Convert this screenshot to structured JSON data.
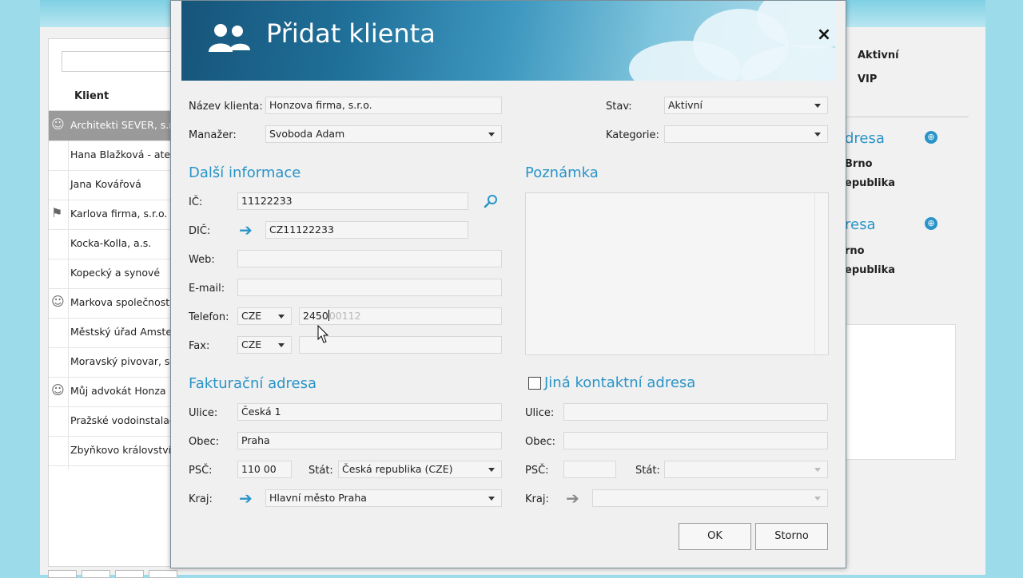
{
  "background_app": {
    "list_header": "Klient",
    "clients": [
      {
        "name": "Architekti SEVER, s.r.o.",
        "icon": "smiley-icon",
        "selected": true
      },
      {
        "name": "Hana Blažková - ateliér",
        "icon": "",
        "selected": false
      },
      {
        "name": "Jana Kovářová",
        "icon": "",
        "selected": false
      },
      {
        "name": "Karlova firma, s.r.o.",
        "icon": "flag-icon",
        "selected": false
      },
      {
        "name": "Kocka-Kolla, a.s.",
        "icon": "",
        "selected": false
      },
      {
        "name": "Kopecký a synové",
        "icon": "",
        "selected": false
      },
      {
        "name": "Markova společnost, s",
        "icon": "smiley-icon",
        "selected": false
      },
      {
        "name": "Městský úřad Amsterd",
        "icon": "",
        "selected": false
      },
      {
        "name": "Moravský pivovar, sp",
        "icon": "",
        "selected": false
      },
      {
        "name": "Můj advokát Honza",
        "icon": "smiley-icon",
        "selected": false
      },
      {
        "name": "Pražské vodoinstalace",
        "icon": "",
        "selected": false
      },
      {
        "name": "Zbyňkovo království",
        "icon": "",
        "selected": false
      }
    ],
    "right_panel": {
      "status1": "Aktivní",
      "status2": "VIP",
      "address1_head": "dresa",
      "address1_city": "Brno",
      "address1_country": "epublika",
      "address2_head": "resa",
      "address2_city": "rno",
      "address2_country": "epublika"
    }
  },
  "dialog": {
    "title": "Přidat klienta",
    "close_symbol": "×",
    "labels": {
      "name": "Název klienta:",
      "manager": "Manažer:",
      "status": "Stav:",
      "category": "Kategorie:",
      "ic": "IČ:",
      "dic": "DIČ:",
      "web": "Web:",
      "email": "E-mail:",
      "phone": "Telefon:",
      "fax": "Fax:",
      "street": "Ulice:",
      "city": "Obec:",
      "zip": "PSČ:",
      "country": "Stát:",
      "region": "Kraj:",
      "street2": "Ulice:",
      "city2": "Obec:",
      "zip2": "PSČ:",
      "country2": "Stát:",
      "region2": "Kraj:"
    },
    "values": {
      "name": "Honzova firma, s.r.o.",
      "manager": "Svoboda Adam",
      "status": "Aktivní",
      "category": "",
      "ic": "11122233",
      "dic": "CZ11122233",
      "web": "",
      "email": "",
      "phone_country": "CZE",
      "phone_typed": "2450",
      "phone_mask": "00112",
      "fax_country": "CZE",
      "fax": "",
      "street": "Česká 1",
      "city": "Praha",
      "zip": "110 00",
      "country": "Česká republika (CZE)",
      "region": "Hlavní město Praha"
    },
    "sections": {
      "more_info": "Další informace",
      "note": "Poznámka",
      "billing": "Fakturační adresa",
      "other_contact": "Jiná kontaktní adresa"
    },
    "other_contact_checked": false,
    "buttons": {
      "ok": "OK",
      "cancel": "Storno"
    },
    "colors": {
      "accent": "#2a94c8",
      "header_dark": "#17547a"
    }
  }
}
